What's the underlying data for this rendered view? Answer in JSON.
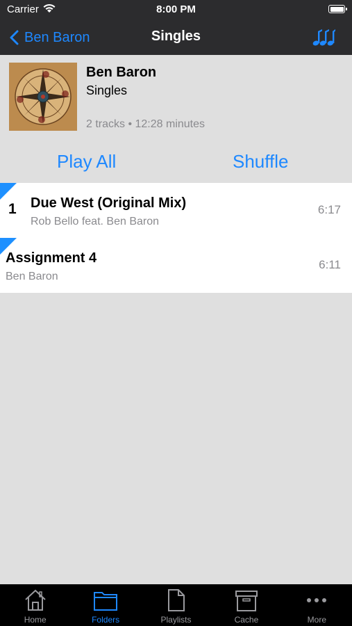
{
  "status_bar": {
    "carrier": "Carrier",
    "time": "8:00 PM"
  },
  "nav": {
    "back_label": "Ben Baron",
    "title": "Singles"
  },
  "album": {
    "artist": "Ben Baron",
    "title": "Singles",
    "meta": "2 tracks • 12:28 minutes"
  },
  "actions": {
    "play_all": "Play All",
    "shuffle": "Shuffle"
  },
  "tracks": [
    {
      "number": "1",
      "title": "Due West (Original Mix)",
      "artist": "Rob Bello feat. Ben Baron",
      "duration": "6:17"
    },
    {
      "number": "",
      "title": "Assignment 4",
      "artist": "Ben Baron",
      "duration": "6:11"
    }
  ],
  "tabs": [
    {
      "label": "Home",
      "icon": "home-icon"
    },
    {
      "label": "Folders",
      "icon": "folder-icon"
    },
    {
      "label": "Playlists",
      "icon": "document-icon"
    },
    {
      "label": "Cache",
      "icon": "archive-box-icon"
    },
    {
      "label": "More",
      "icon": "more-dots-icon"
    }
  ],
  "active_tab": "Folders",
  "colors": {
    "accent": "#1e88ff",
    "bar": "#2c2c2e",
    "background": "#dfdfdf"
  }
}
